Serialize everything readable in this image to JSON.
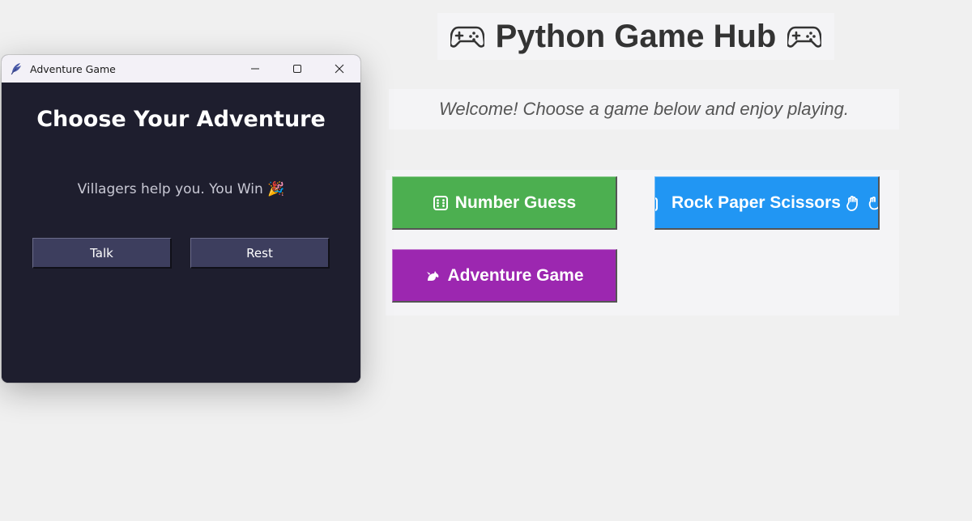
{
  "hub": {
    "title": "Python Game Hub",
    "subtitle": "Welcome! Choose a game below and enjoy playing.",
    "buttons": [
      {
        "label": "Number Guess",
        "icon": "dice-icon",
        "color": "#4caf50"
      },
      {
        "label": "Rock Paper Scissors",
        "icon": "hand-icon",
        "color": "#2196f3"
      },
      {
        "label": "Adventure Game",
        "icon": "dragon-icon",
        "color": "#9c27b0"
      }
    ]
  },
  "adventure_window": {
    "title": "Adventure Game",
    "heading": "Choose Your Adventure",
    "status": "Villagers help you. You Win 🎉",
    "actions": [
      {
        "label": "Talk"
      },
      {
        "label": "Rest"
      }
    ],
    "background_color": "#1e1e2e",
    "button_color": "#3d3e5e"
  }
}
